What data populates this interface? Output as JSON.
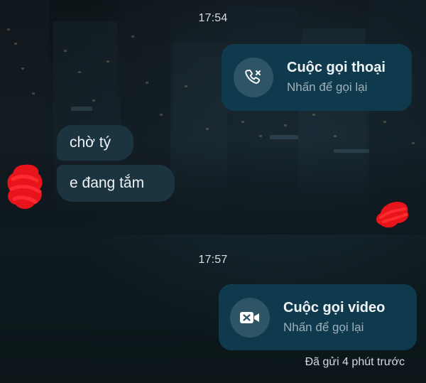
{
  "conversation": {
    "time_1": "17:54",
    "time_2": "17:57",
    "voice_call": {
      "title": "Cuộc gọi thoại",
      "subtitle": "Nhấn để gọi lại",
      "icon": "missed-call-icon"
    },
    "messages": [
      {
        "text": "chờ tý"
      },
      {
        "text": "e đang tắm"
      }
    ],
    "video_call": {
      "title": "Cuộc gọi video",
      "subtitle": "Nhấn để gọi lại",
      "icon": "video-off-icon"
    },
    "status": "Đã gửi 4 phút trước"
  },
  "colors": {
    "background": "#0e1a1f",
    "call_card": "#0f3a4d",
    "icon_circle": "#2e5566",
    "incoming_bubble": "#1c3440",
    "redaction": "#e8141c"
  }
}
